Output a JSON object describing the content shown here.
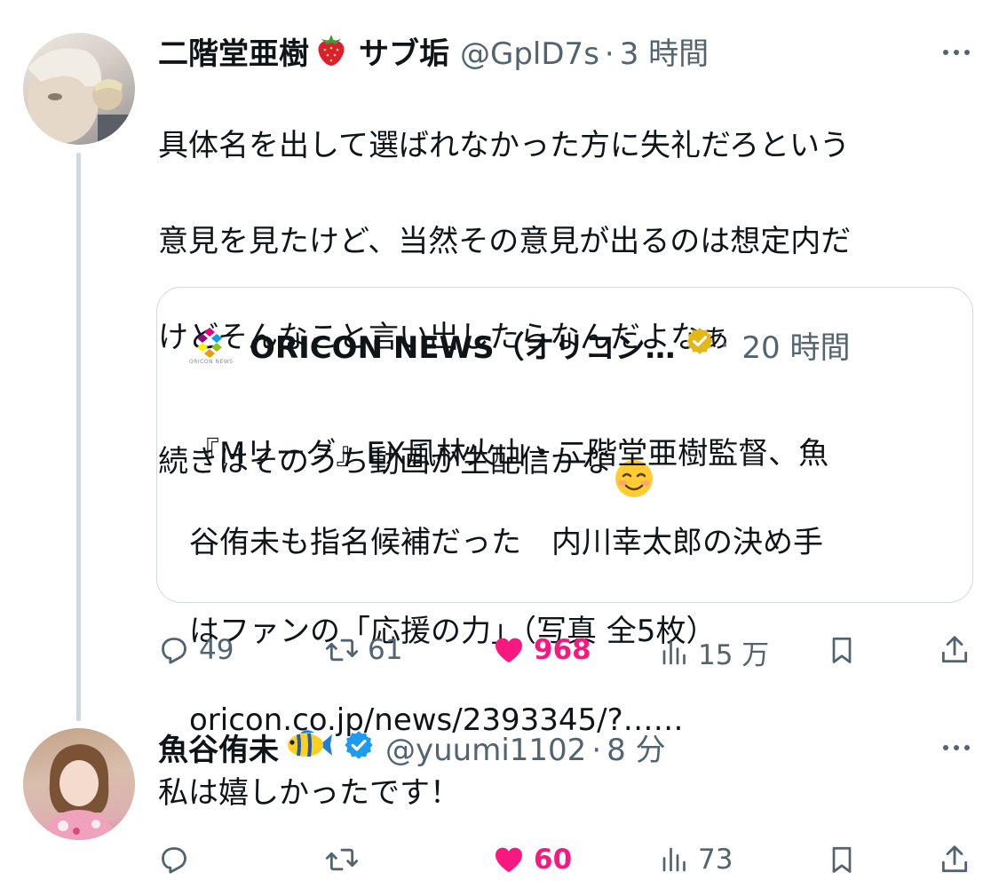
{
  "post1": {
    "name": "二階堂亜樹",
    "name_suffix": "サブ垢",
    "handle": "@GplD7s",
    "separator": "·",
    "time": "3 時間",
    "text_lines": [
      "具体名を出して選ばれなかった方に失礼だろという",
      "意見を見たけど、当然その意見が出るのは想定内だ",
      "けどそんなこと言い出したらなんだよなぁ",
      "続きはそのうち動画か生配信かな"
    ],
    "quote": {
      "account": "ORICON NEWS（オリコン…",
      "logo_caption": "ORICON NEWS",
      "separator": "·",
      "time": "20 時間",
      "text_lines": [
        "『Mリーグ』EX風林火山・二階堂亜樹監督、魚",
        "谷侑未も指名候補だった　内川幸太郎の決め手",
        "はファンの「応援の力」（写真 全5枚）",
        "oricon.co.jp/news/2393345/?……"
      ]
    },
    "actions": {
      "replies": "49",
      "reposts": "61",
      "likes": "968",
      "views": "15 万"
    }
  },
  "post2": {
    "name": "魚谷侑未",
    "handle": "@yuumi1102",
    "separator": "·",
    "time": "8 分",
    "text": "私は嬉しかったです！",
    "actions": {
      "replies": "",
      "reposts": "",
      "likes": "60",
      "views": "73"
    }
  },
  "colors": {
    "like": "#f91880",
    "muted": "#536471",
    "verified_blue": "#1d9bf0",
    "verified_gold": "#e2b719"
  }
}
